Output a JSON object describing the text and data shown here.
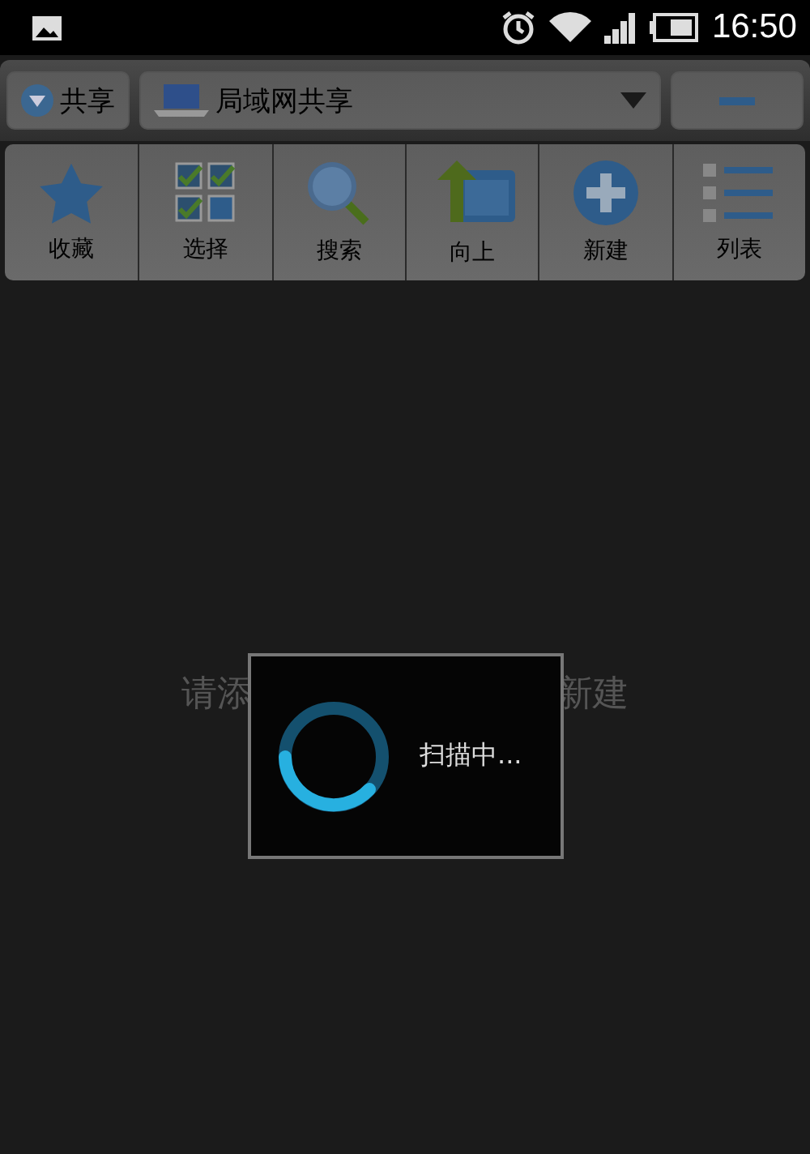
{
  "status_bar": {
    "time": "16:50"
  },
  "location_bar": {
    "share_button": "共享",
    "location": "局域网共享"
  },
  "toolbar": [
    {
      "kind": "star",
      "label": "收藏"
    },
    {
      "kind": "select",
      "label": "选择"
    },
    {
      "kind": "search",
      "label": "搜索"
    },
    {
      "kind": "up",
      "label": "向上"
    },
    {
      "kind": "new",
      "label": "新建"
    },
    {
      "kind": "list",
      "label": "列表"
    }
  ],
  "empty_hint": {
    "visible_start": "请添",
    "visible_end": "新建"
  },
  "dialog": {
    "message": "扫描中..."
  }
}
